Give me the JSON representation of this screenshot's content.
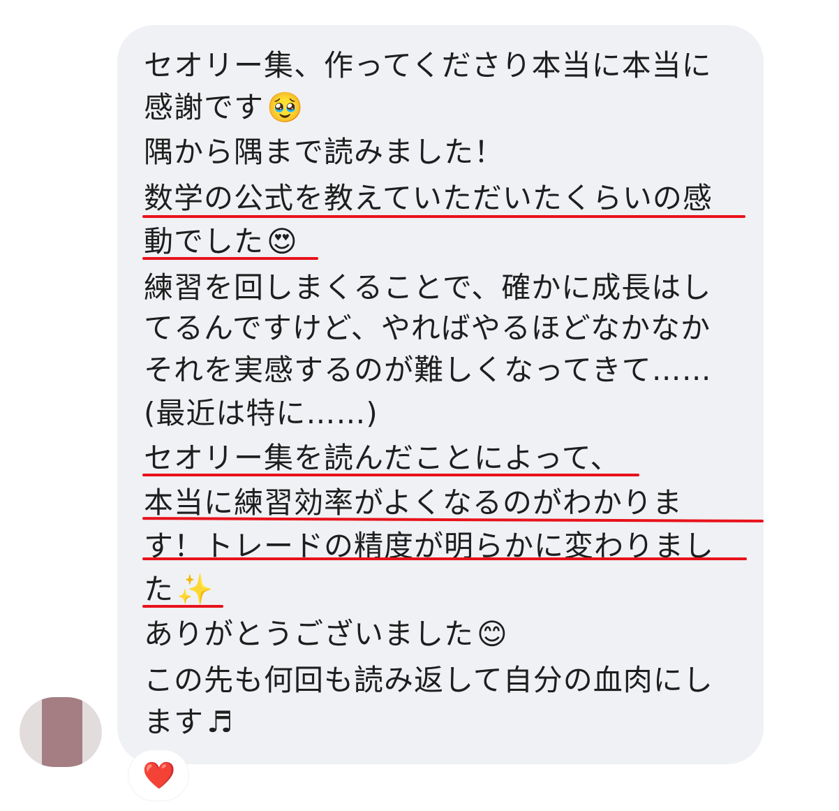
{
  "message": {
    "lines": [
      "セオリー集、作ってくださり本当に本当に",
      "感謝です",
      "隅から隅まで読みました！",
      "数学の公式を教えていただいたくらいの感",
      "動でした",
      "練習を回しまくることで、確かに成長はし",
      "てるんですけど、やればやるほどなかなか",
      "それを実感するのが難しくなってきて……",
      "(最近は特に……)",
      "セオリー集を読んだことによって、",
      "本当に練習効率がよくなるのがわかりま",
      "す！トレードの精度が明らかに変わりまし",
      "た",
      "ありがとうございました",
      "この先も何回も読み返して自分の血肉にし",
      "ます"
    ],
    "emojis": {
      "pleading": "🥹",
      "heart_eyes": "😍",
      "sparkles": "✨",
      "smile": "😊",
      "notes": "♬"
    }
  },
  "reaction": {
    "icon": "heart-icon",
    "glyph": "❤️"
  },
  "colors": {
    "bubble": "#eff1f4",
    "underline": "#e8121b",
    "text": "#1e1e1e"
  }
}
